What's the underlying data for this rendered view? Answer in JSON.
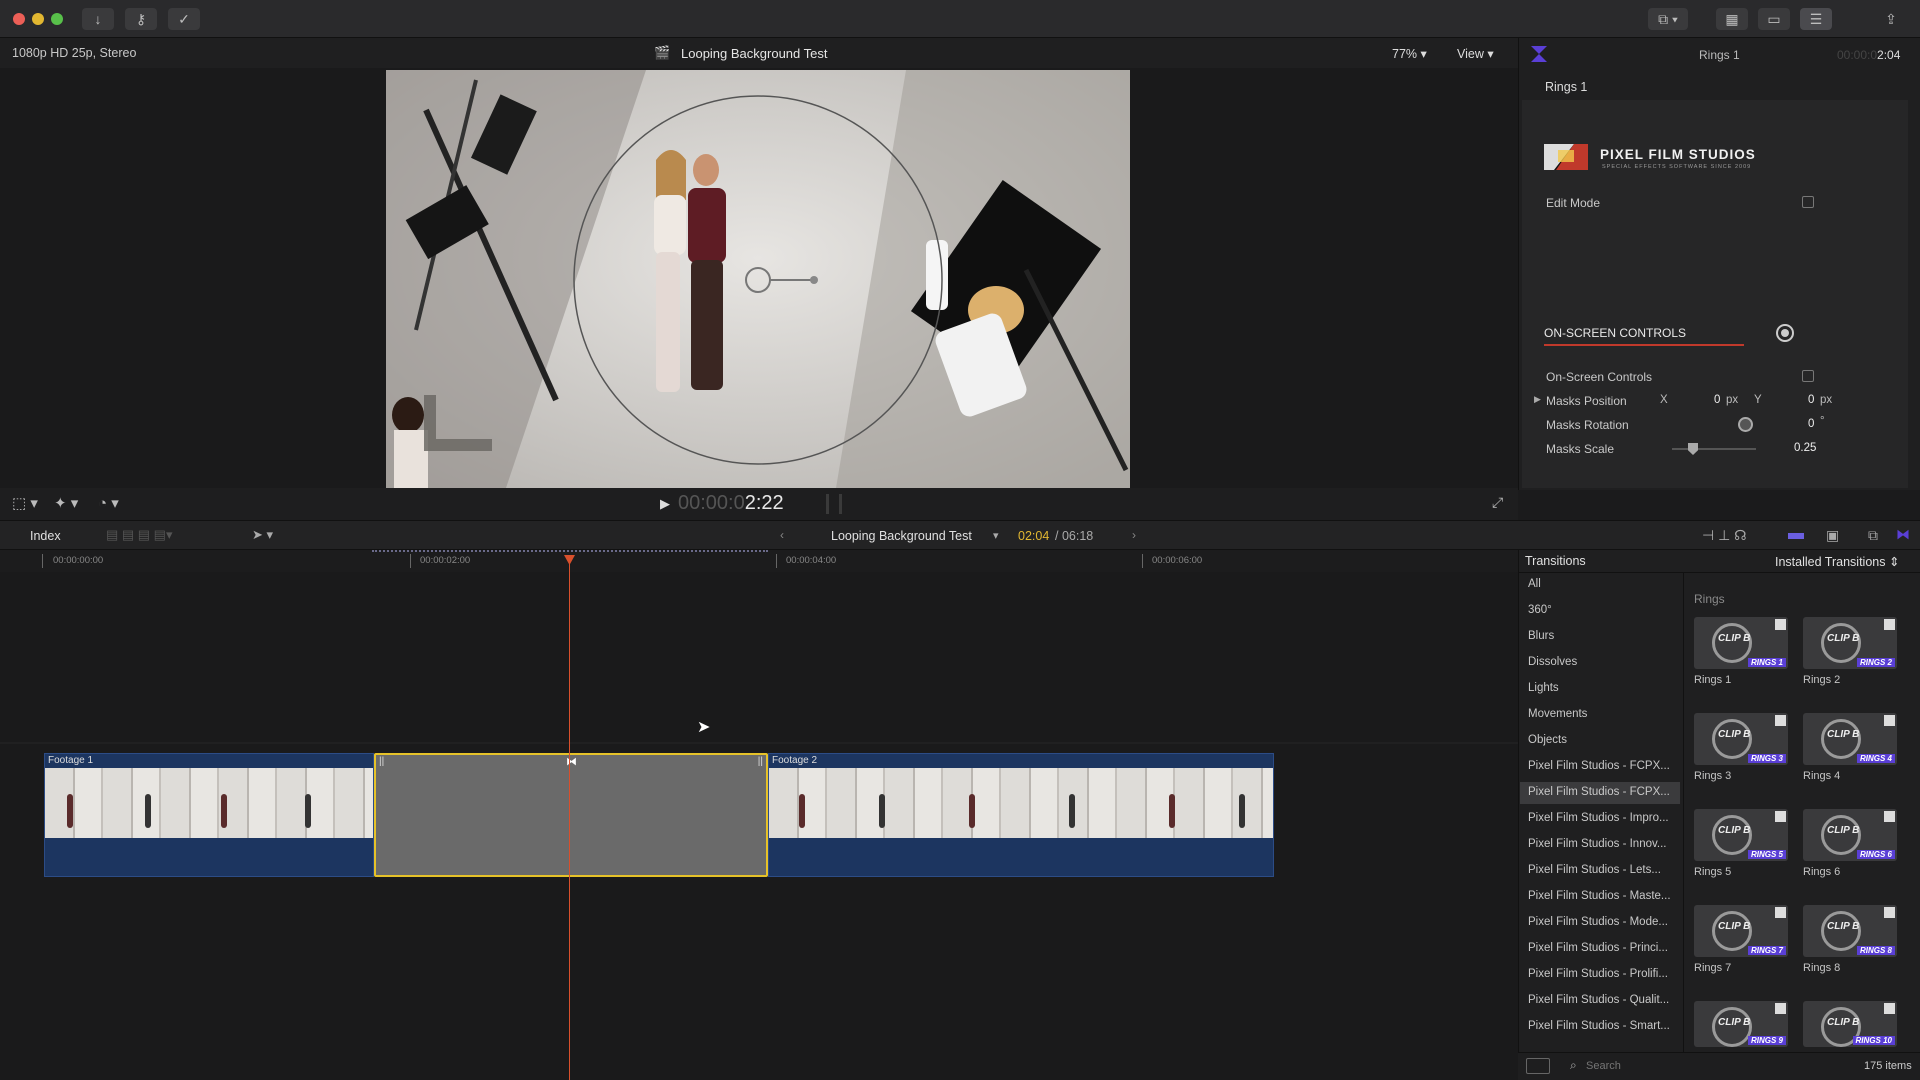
{
  "titlebar": {
    "buttons": [
      "download-icon",
      "key-icon",
      "check-icon"
    ]
  },
  "viewer": {
    "format": "1080p HD 25p, Stereo",
    "project": "Looping Background Test",
    "zoom": "77%",
    "view_label": "View",
    "timecode_dim": "00:00:0",
    "timecode_bright": "2:22"
  },
  "inspector": {
    "header_title": "Rings 1",
    "header_time_dim": "00:00:0",
    "header_time": "2:04",
    "effect_name": "Rings 1",
    "brand": "PIXEL FILM STUDIOS",
    "brand_tagline": "SPECIAL EFFECTS SOFTWARE SINCE 2009",
    "edit_mode_label": "Edit Mode",
    "section_title": "ON-SCREEN CONTROLS",
    "params": [
      {
        "label": "On-Screen Controls"
      },
      {
        "label": "Masks Position",
        "x_label": "X",
        "x_value": "0",
        "x_unit": "px",
        "y_label": "Y",
        "y_value": "0",
        "y_unit": "px"
      },
      {
        "label": "Masks Rotation",
        "value": "0",
        "unit": "°"
      },
      {
        "label": "Masks Scale",
        "value": "0.25"
      }
    ]
  },
  "timeline": {
    "index_label": "Index",
    "project": "Looping Background Test",
    "current": "02:04",
    "total": "/ 06:18",
    "ruler": [
      "00:00:00:00",
      "00:00:02:00",
      "00:00:04:00",
      "00:00:06:00"
    ],
    "clips": [
      {
        "name": "Footage 1"
      },
      {
        "name": "Footage 2"
      }
    ]
  },
  "browser": {
    "title": "Transitions",
    "filter": "Installed Transitions",
    "categories": [
      "All",
      "360°",
      "Blurs",
      "Dissolves",
      "Lights",
      "Movements",
      "Objects",
      "Pixel Film Studios - FCPX...",
      "Pixel Film Studios - FCPX...",
      "Pixel Film Studios - Impro...",
      "Pixel Film Studios - Innov...",
      "Pixel Film Studios - Lets...",
      "Pixel Film Studios - Maste...",
      "Pixel Film Studios - Mode...",
      "Pixel Film Studios - Princi...",
      "Pixel Film Studios - Prolifi...",
      "Pixel Film Studios - Qualit...",
      "Pixel Film Studios - Smart..."
    ],
    "selected_category_index": 8,
    "group_title": "Rings",
    "items": [
      {
        "name": "Rings 1",
        "badge": "RINGS 1"
      },
      {
        "name": "Rings 2",
        "badge": "RINGS 2"
      },
      {
        "name": "Rings 3",
        "badge": "RINGS 3"
      },
      {
        "name": "Rings 4",
        "badge": "RINGS 4"
      },
      {
        "name": "Rings 5",
        "badge": "RINGS 5"
      },
      {
        "name": "Rings 6",
        "badge": "RINGS 6"
      },
      {
        "name": "Rings 7",
        "badge": "RINGS 7"
      },
      {
        "name": "Rings 8",
        "badge": "RINGS 8"
      },
      {
        "name": "",
        "badge": "RINGS 9"
      },
      {
        "name": "",
        "badge": "RINGS 10"
      }
    ],
    "search_placeholder": "Search",
    "count": "175 items",
    "thumb_clip_text": "CLIP B"
  },
  "colors": {
    "accent": "#5a3fd6",
    "playhead": "#d8502c",
    "selection": "#e6c229",
    "clip_blue": "#1c3560"
  }
}
